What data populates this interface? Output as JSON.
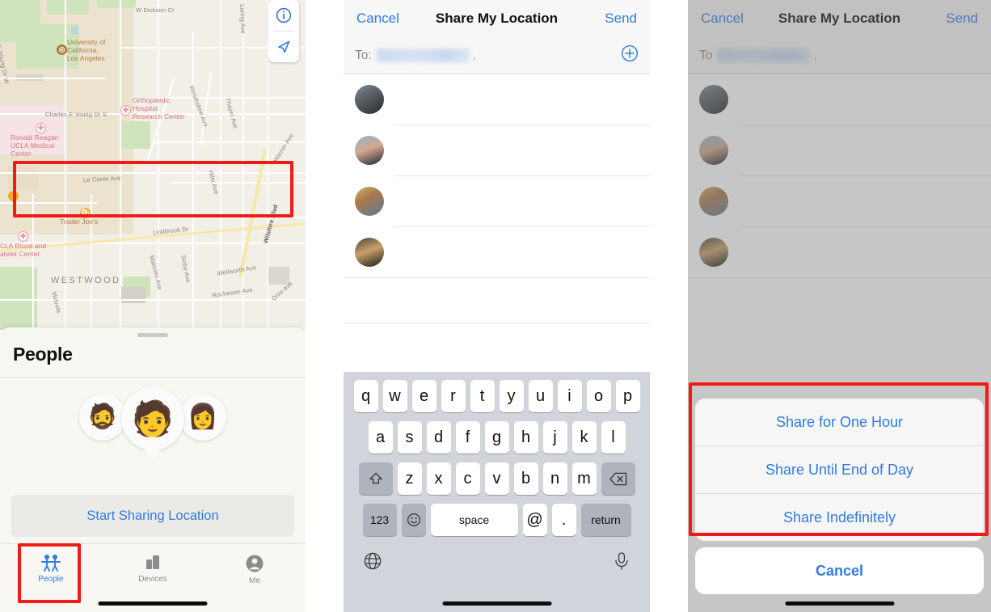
{
  "panels": {
    "find_my": {
      "map": {
        "controls": [
          {
            "name": "info-button",
            "icon": "info-circle-icon"
          },
          {
            "name": "locate-button",
            "icon": "navigation-arrow-icon"
          }
        ],
        "labels": [
          {
            "text": "W Dickson Ct",
            "kind": "street"
          },
          {
            "text": "University of\nCalifornia,\nLos Angeles",
            "kind": "poi"
          },
          {
            "text": "Orthopaedic\nHospital\nResearch Center",
            "kind": "med"
          },
          {
            "text": "Charles E Young Dr S",
            "kind": "street"
          },
          {
            "text": "Ronald Reagan\nUCLA Medical\nCenter",
            "kind": "med"
          },
          {
            "text": "Le Conte Ave",
            "kind": "street"
          },
          {
            "text": "Trader Joe's",
            "kind": "poi"
          },
          {
            "text": "CLA Blood and\natelet Center",
            "kind": "med"
          },
          {
            "text": "WESTWOOD",
            "kind": "hood"
          },
          {
            "text": "Lindbrook Dr",
            "kind": "street"
          },
          {
            "text": "Wilshire Blvd",
            "kind": "street"
          },
          {
            "text": "Westholme Ave",
            "kind": "street"
          },
          {
            "text": "Thayer Ave",
            "kind": "street"
          },
          {
            "text": "Hilts Ave",
            "kind": "street"
          },
          {
            "text": "Warner Ave",
            "kind": "street"
          },
          {
            "text": "Loring Ave",
            "kind": "street"
          },
          {
            "text": "Malcolm Ave",
            "kind": "street"
          },
          {
            "text": "Selby Ave",
            "kind": "street"
          },
          {
            "text": "Wellworth Ave",
            "kind": "street"
          },
          {
            "text": "Rochester Ave",
            "kind": "street"
          },
          {
            "text": "Ohio Ave",
            "kind": "street"
          },
          {
            "text": "Midvale",
            "kind": "street"
          },
          {
            "text": "E Young Dr W",
            "kind": "street"
          }
        ]
      },
      "sheet": {
        "title": "People",
        "memojis": [
          "🧔",
          "🧑",
          "👩"
        ],
        "start_sharing_label": "Start Sharing Location"
      },
      "tabs": [
        {
          "label": "People",
          "icon": "people-icon",
          "active": true
        },
        {
          "label": "Devices",
          "icon": "devices-icon",
          "active": false
        },
        {
          "label": "Me",
          "icon": "person-circle-icon",
          "active": false
        }
      ]
    },
    "share": {
      "nav": {
        "cancel_label": "Cancel",
        "title": "Share My Location",
        "send_label": "Send"
      },
      "to_field": {
        "label": "To:",
        "value": "",
        "trailing_comma": ",",
        "add_icon": "plus-circle-icon"
      },
      "contacts": [
        {
          "name": "",
          "avatar": "contact-photo-1"
        },
        {
          "name": "",
          "avatar": "contact-photo-2"
        },
        {
          "name": "",
          "avatar": "contact-photo-3"
        },
        {
          "name": "",
          "avatar": "contact-photo-4"
        }
      ],
      "keyboard": {
        "row1": [
          "q",
          "w",
          "e",
          "r",
          "t",
          "y",
          "u",
          "i",
          "o",
          "p"
        ],
        "row2": [
          "a",
          "s",
          "d",
          "f",
          "g",
          "h",
          "j",
          "k",
          "l"
        ],
        "row3": [
          "z",
          "x",
          "c",
          "v",
          "b",
          "n",
          "m"
        ],
        "shift_icon": "shift-icon",
        "backspace_icon": "backspace-icon",
        "numbers_label": "123",
        "emoji_icon": "emoji-icon",
        "space_label": "space",
        "at_label": "@",
        "period_label": ".",
        "return_label": "return",
        "globe_icon": "globe-icon",
        "mic_icon": "microphone-icon"
      }
    },
    "duration": {
      "nav": {
        "cancel_label": "Cancel",
        "title": "Share My Location",
        "send_label": "Send"
      },
      "to_field": {
        "label": "To",
        "value": "",
        "trailing_comma": ","
      },
      "action_sheet": {
        "options": [
          "Share for One Hour",
          "Share Until End of Day",
          "Share Indefinitely"
        ],
        "cancel_label": "Cancel"
      }
    }
  },
  "colors": {
    "ios_blue": "#2f7ce0",
    "highlight_red": "#f01b17",
    "map_base": "#f2efe7",
    "park_green": "#cfe3bc",
    "highway_yellow": "#f6e8a8"
  }
}
